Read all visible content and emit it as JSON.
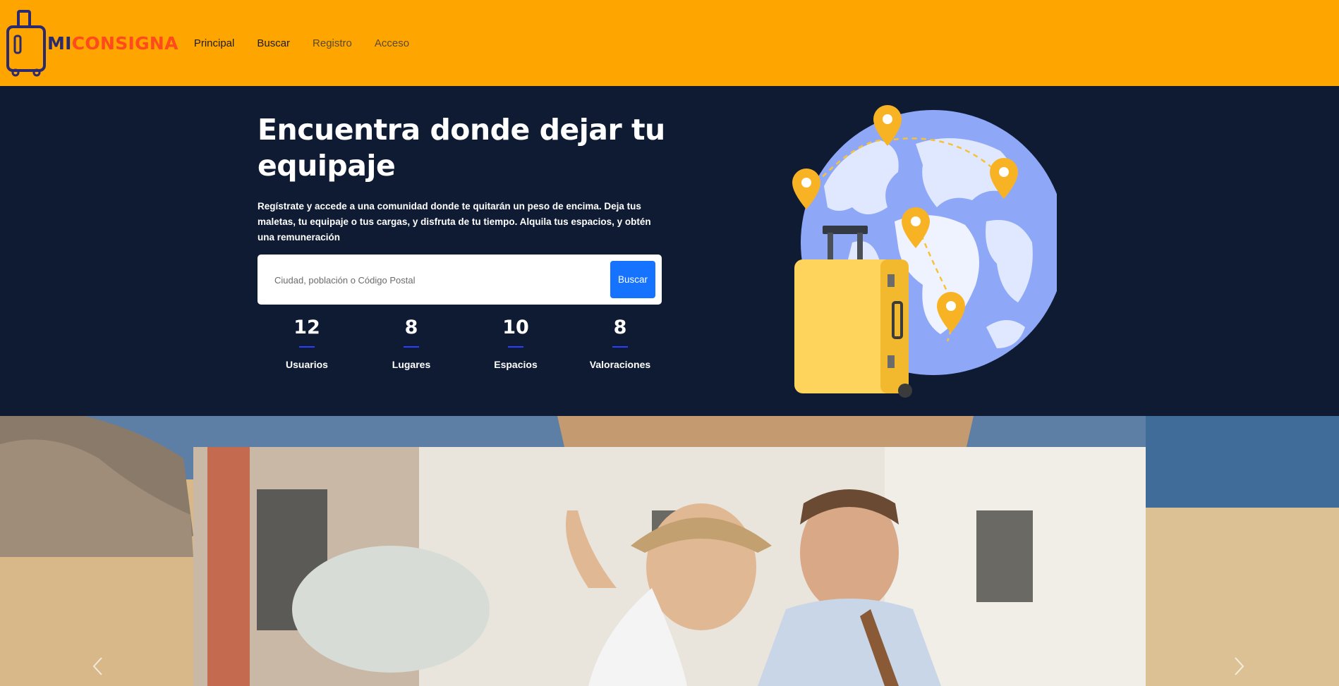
{
  "brand": {
    "mi": "MI",
    "rest": "CONSIGNA"
  },
  "nav": {
    "items": [
      {
        "label": "Principal"
      },
      {
        "label": "Buscar"
      },
      {
        "label": "Registro"
      },
      {
        "label": "Acceso"
      }
    ]
  },
  "hero": {
    "title": "Encuentra donde dejar tu equipaje",
    "text": "Regístrate y accede a una comunidad donde te quitarán un peso de encima. Deja tus maletas, tu equipaje o tus cargas, y disfruta de tu tiempo. Alquila tus espacios, y obtén una remuneración",
    "search": {
      "placeholder": "Ciudad, población o Código Postal",
      "value": "",
      "button": "Buscar"
    },
    "stats": [
      {
        "value": "12",
        "label": "Usuarios"
      },
      {
        "value": "8",
        "label": "Lugares"
      },
      {
        "value": "10",
        "label": "Espacios"
      },
      {
        "value": "8",
        "label": "Valoraciones"
      }
    ]
  },
  "colors": {
    "navbar": "#ffa500",
    "hero_bg": "#0f1b33",
    "button": "#1673ff",
    "brand_mi": "#2b2a6e",
    "brand_rest": "#ff4a1c"
  },
  "icons": {
    "logo": "suitcase-icon",
    "illustration": "globe-suitcase-illustration",
    "prev": "chevron-left-icon",
    "next": "chevron-right-icon"
  }
}
